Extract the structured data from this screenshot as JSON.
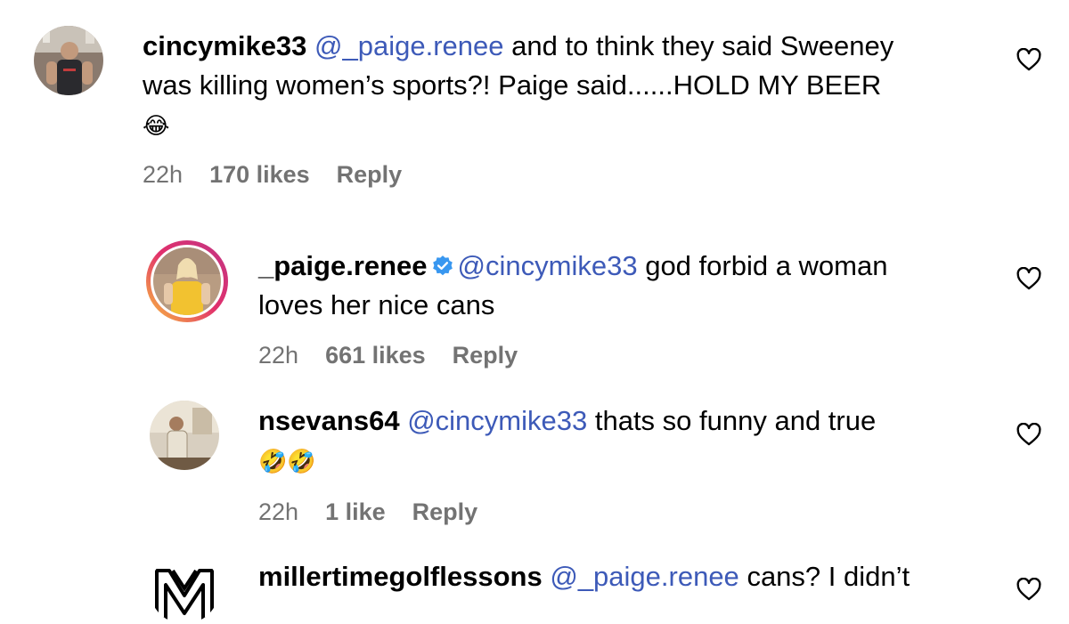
{
  "comments": [
    {
      "username": "cincymike33",
      "mention": "@_paige.renee",
      "text_line1": "and to think they said Sweeney",
      "text_line2": "was killing women’s sports?! Paige said......HOLD MY BEER",
      "emoji": "😂",
      "time": "22h",
      "likes": "170 likes",
      "reply_label": "Reply"
    },
    {
      "username": "_paige.renee",
      "verified": true,
      "mention": "@cincymike33",
      "text_line1": "god forbid a woman",
      "text_line2": "loves her nice cans",
      "time": "22h",
      "likes": "661 likes",
      "reply_label": "Reply"
    },
    {
      "username": "nsevans64",
      "mention": "@cincymike33",
      "text_line1": "thats so funny and true",
      "emoji": "🤣🤣",
      "time": "22h",
      "likes": "1 like",
      "reply_label": "Reply"
    },
    {
      "username": "millertimegolflessons",
      "mention": "@_paige.renee",
      "text_line1": "cans? I didn’t"
    }
  ],
  "icons": {
    "like": "heart-outline-icon",
    "verified": "verified-badge-icon"
  },
  "colors": {
    "mention": "#3d5ab8",
    "meta": "#737373",
    "verified": "#3897f0"
  }
}
